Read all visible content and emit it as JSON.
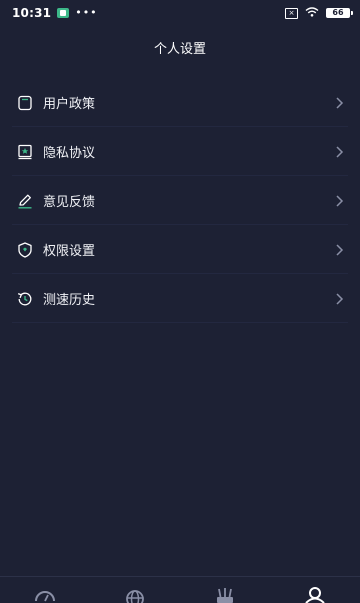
{
  "status_bar": {
    "time": "10:31",
    "dots": "•••",
    "battery": "66"
  },
  "header": {
    "title": "个人设置"
  },
  "settings": {
    "items": [
      {
        "label": "用户政策",
        "icon": "document-icon"
      },
      {
        "label": "隐私协议",
        "icon": "book-icon"
      },
      {
        "label": "意见反馈",
        "icon": "pen-icon"
      },
      {
        "label": "权限设置",
        "icon": "shield-icon"
      },
      {
        "label": "测速历史",
        "icon": "history-icon"
      }
    ]
  },
  "bottom_nav": {
    "tabs": [
      {
        "icon": "speedometer-icon"
      },
      {
        "icon": "globe-icon"
      },
      {
        "icon": "router-icon"
      },
      {
        "icon": "user-icon",
        "active": true
      }
    ]
  },
  "colors": {
    "background": "#1d2134",
    "divider": "#232840",
    "text": "#ffffff",
    "muted": "#8a8fa6",
    "accent": "#3db889"
  }
}
